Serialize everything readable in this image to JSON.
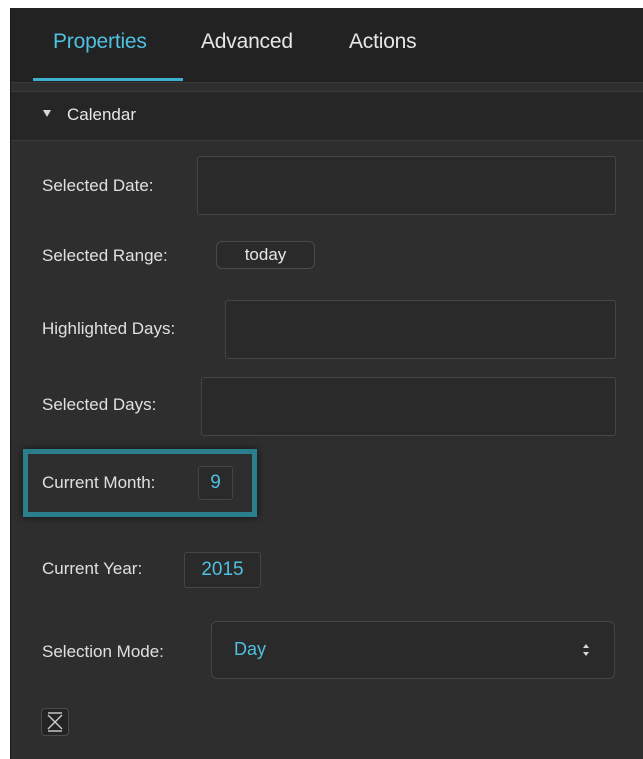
{
  "tabs": {
    "properties": "Properties",
    "advanced": "Advanced",
    "actions": "Actions",
    "active": "Properties"
  },
  "section": {
    "title": "Calendar",
    "icon": "triangle-down-icon"
  },
  "fields": {
    "selected_date": {
      "label": "Selected Date:",
      "value": ""
    },
    "selected_range": {
      "label": "Selected Range:",
      "value": "today"
    },
    "highlighted_days": {
      "label": "Highlighted Days:",
      "value": ""
    },
    "selected_days": {
      "label": "Selected Days:",
      "value": ""
    },
    "current_month": {
      "label": "Current Month:",
      "value": "9"
    },
    "current_year": {
      "label": "Current Year:",
      "value": "2015"
    },
    "selection_mode": {
      "label": "Selection Mode:",
      "value": "Day",
      "icon": "select-arrows-icon"
    }
  },
  "footer": {
    "collapse_icon": "collapse-icon"
  },
  "colors": {
    "accent": "#4fc0e0",
    "highlight": "#2b7f8d",
    "panel_bg": "#2e2e2e",
    "tabbar_bg": "#222222"
  }
}
